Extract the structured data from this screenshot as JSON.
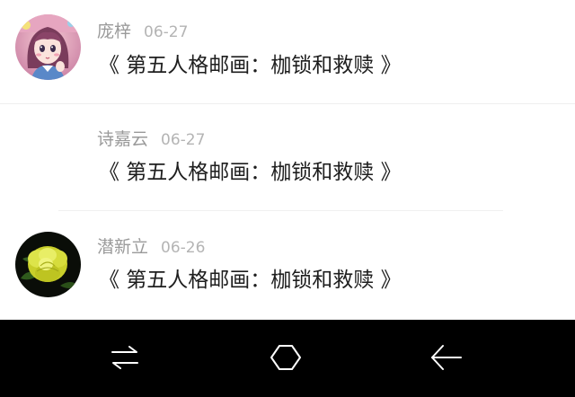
{
  "feed": {
    "items": [
      {
        "name": "庞梓",
        "date": "06-27",
        "title": "《 第五人格邮画：枷锁和救赎 》",
        "avatar": "anime-girl-avatar"
      },
      {
        "name": "诗嘉云",
        "date": "06-27",
        "title": "《 第五人格邮画：枷锁和救赎 》",
        "avatar": ""
      },
      {
        "name": "潜新立",
        "date": "06-26",
        "title": "《 第五人格邮画：枷锁和救赎 》",
        "avatar": "yellow-flower-avatar"
      }
    ]
  },
  "navbar": {
    "buttons": [
      "switch-apps-icon",
      "home-icon",
      "back-icon"
    ],
    "background": "#000000",
    "icon_color": "#ffffff"
  },
  "colors": {
    "name_text": "#9a9a9a",
    "date_text": "#b4b4b4",
    "title_text": "#1e1e1e",
    "divider": "#ededed"
  }
}
